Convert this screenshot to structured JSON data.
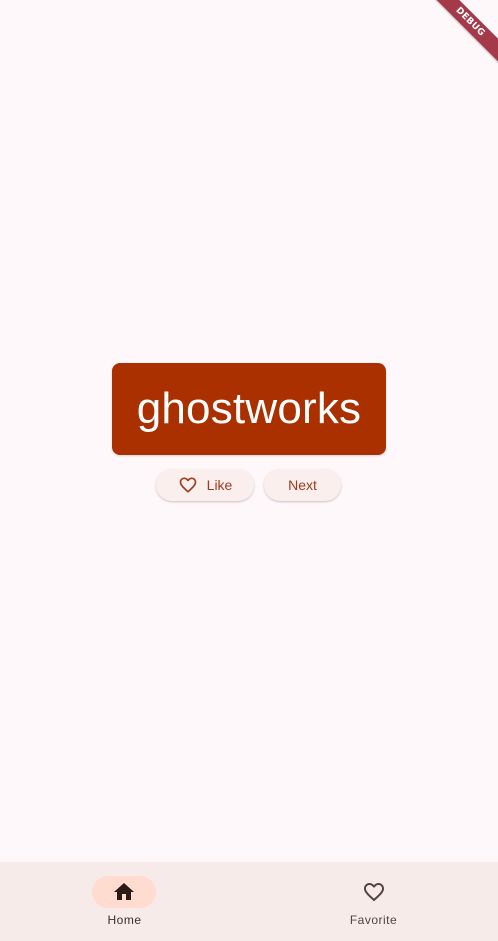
{
  "app": {
    "debug_banner": "DEBUG"
  },
  "main": {
    "word": "ghostworks",
    "like_button_label": "Like",
    "like_icon": "heart-outline-icon",
    "next_button_label": "Next"
  },
  "navigation": {
    "items": [
      {
        "label": "Home",
        "icon": "home-icon",
        "selected": true
      },
      {
        "label": "Favorite",
        "icon": "heart-outline-icon",
        "selected": false
      }
    ]
  },
  "colors": {
    "accent": "#AB3000",
    "background": "#FFF8FB",
    "button_text": "#9E3A1F",
    "nav_background": "#F7EBEA",
    "nav_indicator": "#FFDBD0",
    "debug_ribbon": "#A4394A"
  }
}
